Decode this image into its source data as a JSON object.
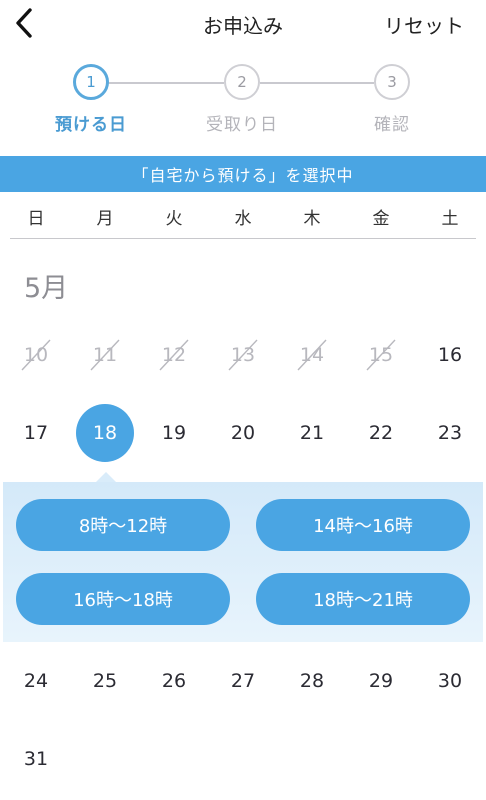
{
  "header": {
    "title": "お申込み",
    "reset_label": "リセット"
  },
  "stepper": {
    "steps": [
      {
        "number": "1",
        "label": "預ける日",
        "active": true
      },
      {
        "number": "2",
        "label": "受取り日",
        "active": false
      },
      {
        "number": "3",
        "label": "確認",
        "active": false
      }
    ]
  },
  "banner": {
    "text": "「自宅から預ける」を選択中"
  },
  "calendar": {
    "weekdays": [
      "日",
      "月",
      "火",
      "水",
      "木",
      "金",
      "土"
    ],
    "month": "5月",
    "week1": [
      "10",
      "11",
      "12",
      "13",
      "14",
      "15",
      "16"
    ],
    "week2": [
      "17",
      "18",
      "19",
      "20",
      "21",
      "22",
      "23"
    ],
    "week3": [
      "24",
      "25",
      "26",
      "27",
      "28",
      "29",
      "30"
    ],
    "week4": [
      "31"
    ],
    "selected_day": "18"
  },
  "time_slots": [
    "8時〜12時",
    "14時〜16時",
    "16時〜18時",
    "18時〜21時"
  ],
  "colors": {
    "accent": "#4aa5e3",
    "text": "#2b2b33",
    "muted": "#b8b8be"
  }
}
